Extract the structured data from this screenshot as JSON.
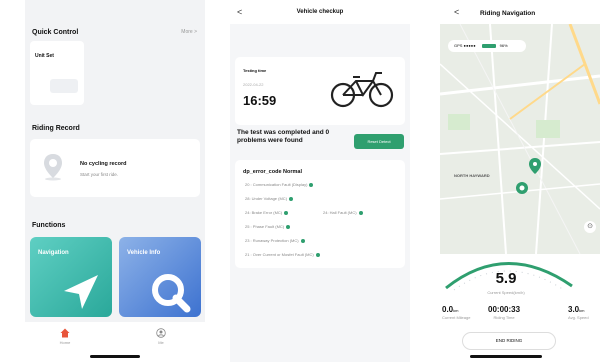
{
  "screen1": {
    "quick_control": {
      "title": "Quick Control",
      "more": "More >"
    },
    "unit_set": {
      "label": "Unit Set"
    },
    "riding_record": {
      "title": "Riding Record",
      "empty_title": "No cycling record",
      "empty_sub": "Start your first ride."
    },
    "functions": {
      "title": "Functions",
      "tiles": [
        {
          "label": "Navigation",
          "icon": "navigation-arrow-icon",
          "color": "#3fbcad"
        },
        {
          "label": "Vehicle Info",
          "icon": "magnifier-q-icon",
          "color": "#5b8fe0"
        }
      ]
    },
    "tabbar": {
      "tabs": [
        {
          "label": "Home",
          "icon": "home-icon",
          "active": true,
          "color": "#e8553b"
        },
        {
          "label": "Me",
          "icon": "profile-icon",
          "active": false
        }
      ]
    }
  },
  "screen2": {
    "title": "Vehicle checkup",
    "back": "<",
    "testing": {
      "label": "Testing time",
      "date": "2022-04-22",
      "time": "16:59"
    },
    "result_text": "The test was completed and 0 problems were found",
    "reset_button": "Reset Detect",
    "error_title": "dp_error_code Normal",
    "errors": [
      "20 : Communication Fault (Display)",
      "28: Under Voltage (MC)",
      "24: Brake Error (MC)",
      "24: Hall Fault (MC)",
      "25 : Phase Fault (MC)",
      "23 : Runaway Protection (MC)",
      "21 : Over Current or Mosfet Fault (MC)"
    ],
    "accent": "#2f9f6f"
  },
  "screen3": {
    "title": "Riding Navigation",
    "back": "<",
    "gps": {
      "label": "GPS ●●●●●",
      "battery": "96%"
    },
    "area": "NORTH HAYWARD",
    "speed": {
      "value": "5.9",
      "label": "Current Speed(km/h)"
    },
    "stats": [
      {
        "value": "0.0",
        "unit": "km",
        "label": "Current Mileage"
      },
      {
        "value": "00:00:33",
        "unit": "",
        "label": "Riding Time"
      },
      {
        "value": "3.0",
        "unit": "km",
        "label": "Avg. Speed"
      }
    ],
    "end_button": "END RIDING"
  }
}
